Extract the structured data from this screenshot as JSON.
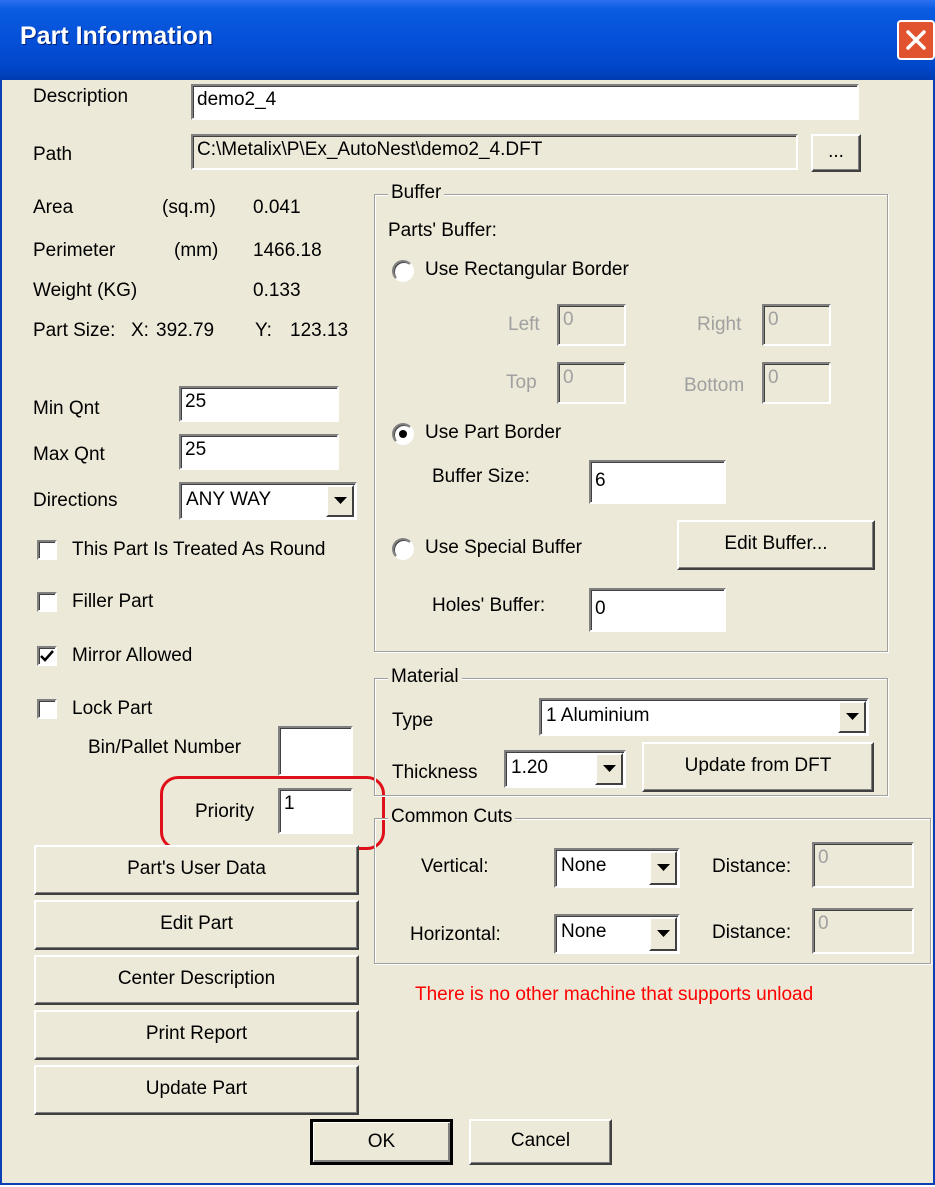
{
  "window": {
    "title": "Part Information"
  },
  "description": {
    "label": "Description",
    "value": "demo2_4"
  },
  "path": {
    "label": "Path",
    "value": "C:\\Metalix\\P\\Ex_AutoNest\\demo2_4.DFT",
    "browse_label": "..."
  },
  "area": {
    "label": "Area",
    "unit": "(sq.m)",
    "value": "0.041"
  },
  "perimeter": {
    "label": "Perimeter",
    "unit": "(mm)",
    "value": "1466.18"
  },
  "weight": {
    "label": "Weight (KG)",
    "value": "0.133"
  },
  "part_size": {
    "label": "Part Size:",
    "x_label": "X:",
    "x_value": "392.79",
    "y_label": "Y:",
    "y_value": "123.13"
  },
  "min_qnt": {
    "label": "Min Qnt",
    "value": "25"
  },
  "max_qnt": {
    "label": "Max Qnt",
    "value": "25"
  },
  "directions": {
    "label": "Directions",
    "value": "ANY WAY"
  },
  "checkboxes": {
    "round": {
      "label": "This Part Is Treated As Round",
      "checked": false
    },
    "filler": {
      "label": "Filler Part",
      "checked": false
    },
    "mirror": {
      "label": "Mirror Allowed",
      "checked": true
    },
    "lock": {
      "label": "Lock Part",
      "checked": false
    }
  },
  "bin_pallet": {
    "label": "Bin/Pallet Number",
    "value": ""
  },
  "priority": {
    "label": "Priority",
    "value": "1"
  },
  "left_buttons": {
    "user_data": "Part's User Data",
    "edit_part": "Edit Part",
    "center_desc": "Center Description",
    "print_report": "Print Report",
    "update_part": "Update Part"
  },
  "buffer": {
    "title": "Buffer",
    "parts_buffer_label": "Parts' Buffer:",
    "rect_border": {
      "label": "Use Rectangular Border",
      "selected": false
    },
    "left": {
      "label": "Left",
      "value": "0"
    },
    "right": {
      "label": "Right",
      "value": "0"
    },
    "top": {
      "label": "Top",
      "value": "0"
    },
    "bottom": {
      "label": "Bottom",
      "value": "0"
    },
    "part_border": {
      "label": "Use Part Border",
      "selected": true
    },
    "buffer_size": {
      "label": "Buffer Size:",
      "value": "6"
    },
    "special_buffer": {
      "label": "Use Special Buffer",
      "selected": false
    },
    "edit_buffer_label": "Edit Buffer...",
    "holes_buffer": {
      "label": "Holes' Buffer:",
      "value": "0"
    }
  },
  "material": {
    "title": "Material",
    "type_label": "Type",
    "type_value": "1  Aluminium",
    "thickness_label": "Thickness",
    "thickness_value": "1.20",
    "update_label": "Update from DFT"
  },
  "common_cuts": {
    "title": "Common Cuts",
    "vertical_label": "Vertical:",
    "vertical_value": "None",
    "vertical_distance_label": "Distance:",
    "vertical_distance_value": "0",
    "horizontal_label": "Horizontal:",
    "horizontal_value": "None",
    "horizontal_distance_label": "Distance:",
    "horizontal_distance_value": "0"
  },
  "warning": "There is no other machine that supports unload",
  "ok_label": "OK",
  "cancel_label": "Cancel",
  "colors": {
    "title_bar": "#0550d8",
    "dialog_bg": "#ece9d8",
    "warning": "#ff0000",
    "highlight": "#e0101a"
  }
}
